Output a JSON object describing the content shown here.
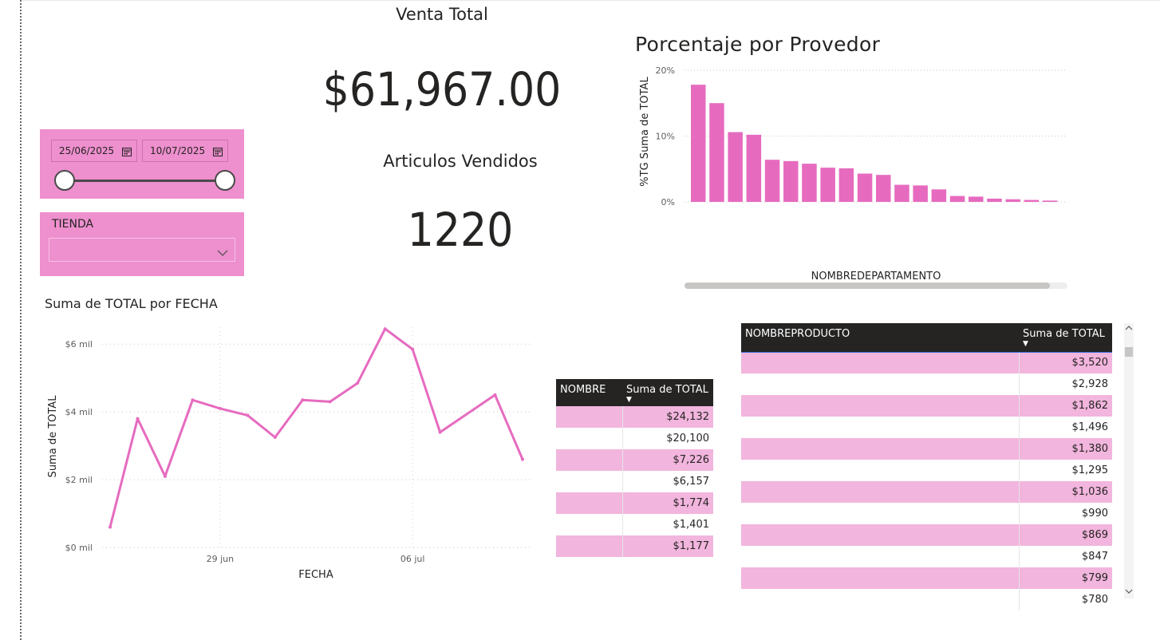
{
  "kpis": {
    "venta_title": "Venta Total",
    "venta_value": "$61,967.00",
    "articulos_title": "Articulos Vendidos",
    "articulos_value": "1220"
  },
  "date_slicer": {
    "start": "25/06/2025",
    "end": "10/07/2025",
    "icon": "calendar-icon",
    "range_fraction": [
      0,
      1
    ]
  },
  "tienda_slicer": {
    "label": "TIENDA",
    "value": "",
    "icon": "chevron-down-icon"
  },
  "colors": {
    "accent": "#e66bbf",
    "slicer_bg": "#ee8fce",
    "row_highlight": "#f2b5dd",
    "header_bg": "#252423"
  },
  "bar_chart": {
    "title": "Porcentaje por Provedor",
    "ylabel": "%TG Suma de TOTAL",
    "xlabel": "NOMBREDEPARTAMENTO"
  },
  "line_chart": {
    "title": "Suma de TOTAL por FECHA",
    "ylabel": "Suma de TOTAL",
    "xlabel": "FECHA"
  },
  "table_nombre": {
    "headers": [
      "NOMBRE",
      "Suma de TOTAL"
    ],
    "rows": [
      {
        "name": "",
        "total": "$24,132"
      },
      {
        "name": "",
        "total": "$20,100"
      },
      {
        "name": "",
        "total": "$7,226"
      },
      {
        "name": "",
        "total": "$6,157"
      },
      {
        "name": "",
        "total": "$1,774"
      },
      {
        "name": "",
        "total": "$1,401"
      },
      {
        "name": "",
        "total": "$1,177"
      }
    ]
  },
  "table_producto": {
    "headers": [
      "NOMBREPRODUCTO",
      "Suma de TOTAL"
    ],
    "rows": [
      {
        "name": "",
        "total": "$3,520"
      },
      {
        "name": "",
        "total": "$2,928"
      },
      {
        "name": "",
        "total": "$1,862"
      },
      {
        "name": "",
        "total": "$1,496"
      },
      {
        "name": "",
        "total": "$1,380"
      },
      {
        "name": "",
        "total": "$1,295"
      },
      {
        "name": "",
        "total": "$1,036"
      },
      {
        "name": "",
        "total": "$990"
      },
      {
        "name": "",
        "total": "$869"
      },
      {
        "name": "",
        "total": "$847"
      },
      {
        "name": "",
        "total": "$799"
      },
      {
        "name": "",
        "total": "$780"
      }
    ],
    "scroll_icons": [
      "scroll-up-icon",
      "scroll-down-icon"
    ]
  },
  "chart_data": [
    {
      "type": "bar",
      "title": "Porcentaje por Provedor",
      "xlabel": "NOMBREDEPARTAMENTO",
      "ylabel": "%TG Suma de TOTAL",
      "categories": [],
      "values": [
        17.8,
        15.0,
        10.6,
        10.2,
        6.4,
        6.2,
        5.8,
        5.2,
        5.1,
        4.3,
        4.1,
        2.6,
        2.5,
        1.9,
        0.9,
        0.8,
        0.5,
        0.4,
        0.3,
        0.2
      ],
      "ylim": [
        0,
        20
      ],
      "yticks": [
        "0%",
        "10%",
        "20%"
      ],
      "yticks_values": [
        0,
        10,
        20
      ],
      "grid": true,
      "color": "#e66bbf"
    },
    {
      "type": "line",
      "title": "Suma de TOTAL por FECHA",
      "xlabel": "FECHA",
      "ylabel": "Suma de TOTAL",
      "x": [
        "2025-06-25",
        "2025-06-26",
        "2025-06-27",
        "2025-06-28",
        "2025-06-29",
        "2025-06-30",
        "2025-07-01",
        "2025-07-02",
        "2025-07-03",
        "2025-07-04",
        "2025-07-05",
        "2025-07-06",
        "2025-07-07",
        "2025-07-09",
        "2025-07-10"
      ],
      "series": [
        {
          "values": [
            600,
            3800,
            2100,
            4350,
            4100,
            3900,
            3250,
            4350,
            4300,
            4850,
            6450,
            5850,
            3400,
            4500,
            2600
          ]
        }
      ],
      "ylim": [
        0,
        6500
      ],
      "yticks": [
        "$0 mil",
        "$2 mil",
        "$4 mil",
        "$6 mil"
      ],
      "yticks_values": [
        0,
        2000,
        4000,
        6000
      ],
      "xticks": [
        "29 jun",
        "06 jul"
      ],
      "xticks_values": [
        "2025-06-29",
        "2025-07-06"
      ],
      "xrange": [
        "2025-06-25",
        "2025-07-10"
      ],
      "grid": true,
      "color": "#e66bbf"
    }
  ]
}
